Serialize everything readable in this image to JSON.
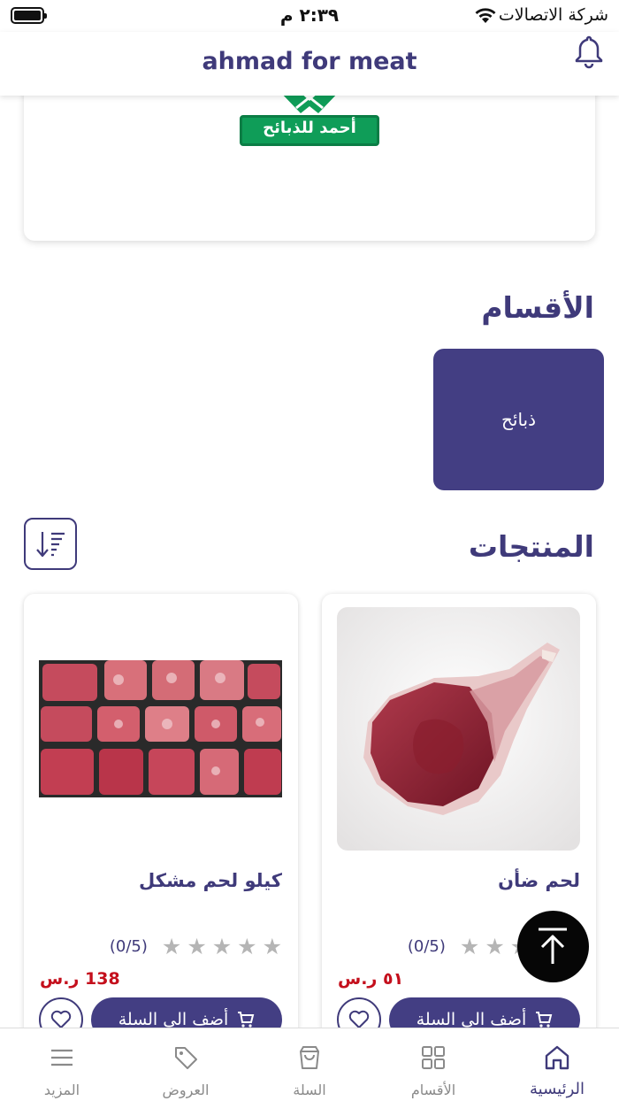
{
  "status_bar": {
    "time": "٢:٣٩ م",
    "carrier": "شركة الاتصالات"
  },
  "header": {
    "title": "ahmad for meat"
  },
  "banner": {
    "logo_text": "أحمد للذبائح"
  },
  "categories": {
    "title": "الأقسام",
    "items": [
      {
        "label": "ذبائح"
      }
    ]
  },
  "products": {
    "title": "المنتجات",
    "items": [
      {
        "name": "لحم ضأن",
        "rating": "(0/5)",
        "price": "٥١ ر.س",
        "add_label": "أضف الى السلة"
      },
      {
        "name": "كيلو لحم مشكل",
        "rating": "(0/5)",
        "price": "138 ر.س",
        "add_label": "أضف الى السلة"
      }
    ]
  },
  "bottom_nav": {
    "items": [
      {
        "label": "الرئيسية",
        "icon": "home-icon",
        "active": true
      },
      {
        "label": "الأقسام",
        "icon": "grid-icon",
        "active": false
      },
      {
        "label": "السلة",
        "icon": "bag-icon",
        "active": false
      },
      {
        "label": "العروض",
        "icon": "tag-icon",
        "active": false
      },
      {
        "label": "المزيد",
        "icon": "menu-icon",
        "active": false
      }
    ]
  },
  "colors": {
    "primary": "#433e83",
    "price": "#c40f1c",
    "logo_green": "#0f9d58"
  }
}
